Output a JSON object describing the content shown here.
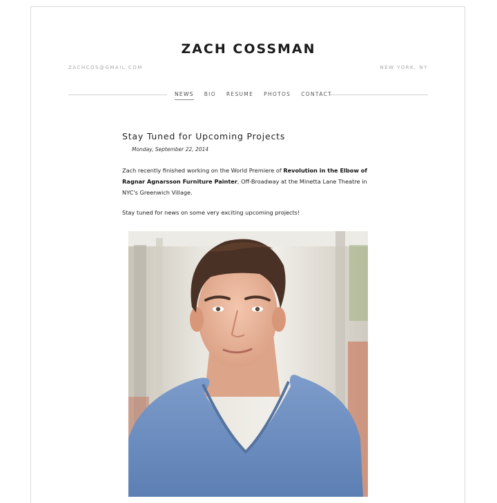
{
  "site": {
    "title": "ZACH COSSMAN",
    "email": "ZACHCOS@GMAIL.COM",
    "location": "NEW YORK, NY"
  },
  "nav": {
    "items": [
      {
        "label": "NEWS",
        "active": true
      },
      {
        "label": "BIO",
        "active": false
      },
      {
        "label": "RESUME",
        "active": false
      },
      {
        "label": "PHOTOS",
        "active": false
      },
      {
        "label": "CONTACT",
        "active": false
      }
    ]
  },
  "post": {
    "title": "Stay Tuned for Upcoming Projects",
    "date": "Monday, September 22, 2014",
    "para1_before": "Zach recently finished working on the World Premiere of ",
    "para1_bold": "Revolution in the Elbow of Ragnar Agnarsson Furniture Painter",
    "para1_after": ", Off-Broadway at the Minetta Lane Theatre in NYC's Greenwich Village.",
    "para2": "Stay tuned for news on some very exciting upcoming projects!"
  },
  "colors": {
    "shirt": "#6f8fbf",
    "skin": "#e8b79e",
    "hair": "#4a3125",
    "background_blur": "#d9d6d0"
  }
}
